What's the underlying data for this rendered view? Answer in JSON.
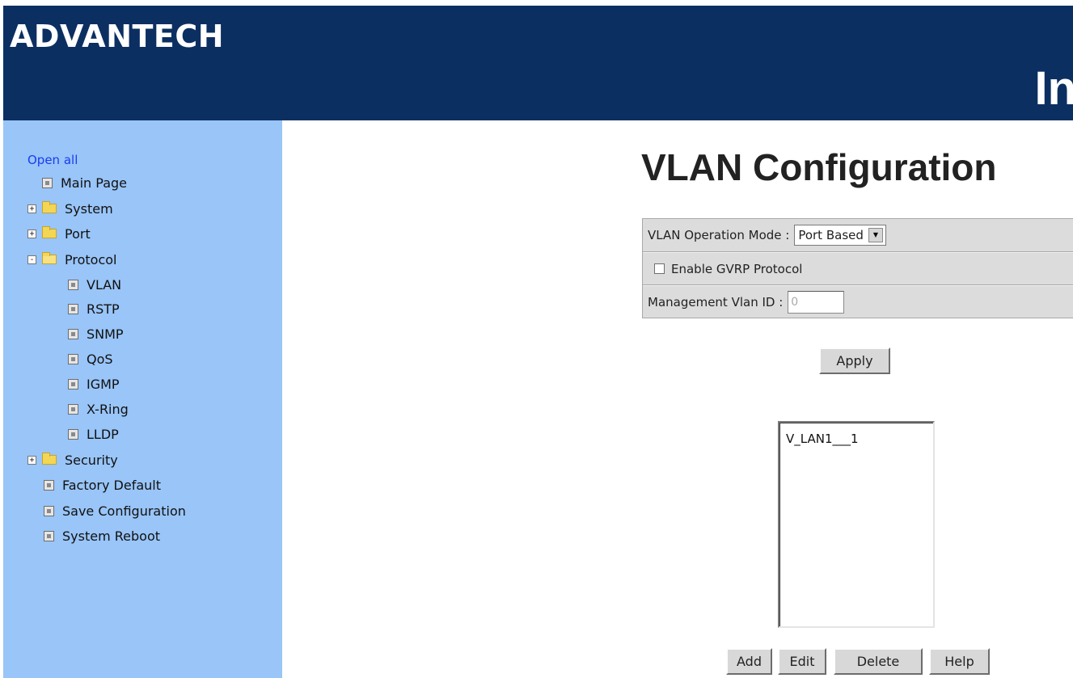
{
  "banner": {
    "logo_text": "ADVANTECH",
    "title_fragment": "In"
  },
  "sidebar": {
    "open_all": "Open all",
    "items": [
      {
        "label": "Main Page",
        "icon": "page-icon"
      },
      {
        "label": "System",
        "icon": "folder-icon",
        "expander": "+"
      },
      {
        "label": "Port",
        "icon": "folder-icon",
        "expander": "+"
      },
      {
        "label": "Protocol",
        "icon": "folder-open-icon",
        "expander": "-"
      },
      {
        "label": "VLAN",
        "icon": "page-icon"
      },
      {
        "label": "RSTP",
        "icon": "page-icon"
      },
      {
        "label": "SNMP",
        "icon": "page-icon"
      },
      {
        "label": "QoS",
        "icon": "page-icon"
      },
      {
        "label": "IGMP",
        "icon": "page-icon"
      },
      {
        "label": "X-Ring",
        "icon": "page-icon"
      },
      {
        "label": "LLDP",
        "icon": "page-icon"
      },
      {
        "label": "Security",
        "icon": "folder-icon",
        "expander": "+"
      },
      {
        "label": "Factory Default",
        "icon": "page-icon"
      },
      {
        "label": "Save Configuration",
        "icon": "page-icon"
      },
      {
        "label": "System Reboot",
        "icon": "page-icon"
      }
    ]
  },
  "main": {
    "title": "VLAN Configuration",
    "operation_mode": {
      "label": "VLAN Operation Mode :",
      "value": "Port Based"
    },
    "gvrp": {
      "label": "Enable GVRP Protocol",
      "checked": false
    },
    "mgmt_vlan": {
      "label": "Management Vlan ID :",
      "value": "0"
    },
    "apply_label": "Apply",
    "vlan_list": [
      "V_LAN1___1"
    ],
    "buttons": {
      "add": "Add",
      "edit": "Edit",
      "delete": "Delete",
      "help": "Help"
    }
  },
  "colors": {
    "banner_bg": "#0c2f62",
    "sidebar_bg": "#99c5f8",
    "link": "#1a3cf0",
    "panel_bg": "#dcdcdc"
  }
}
